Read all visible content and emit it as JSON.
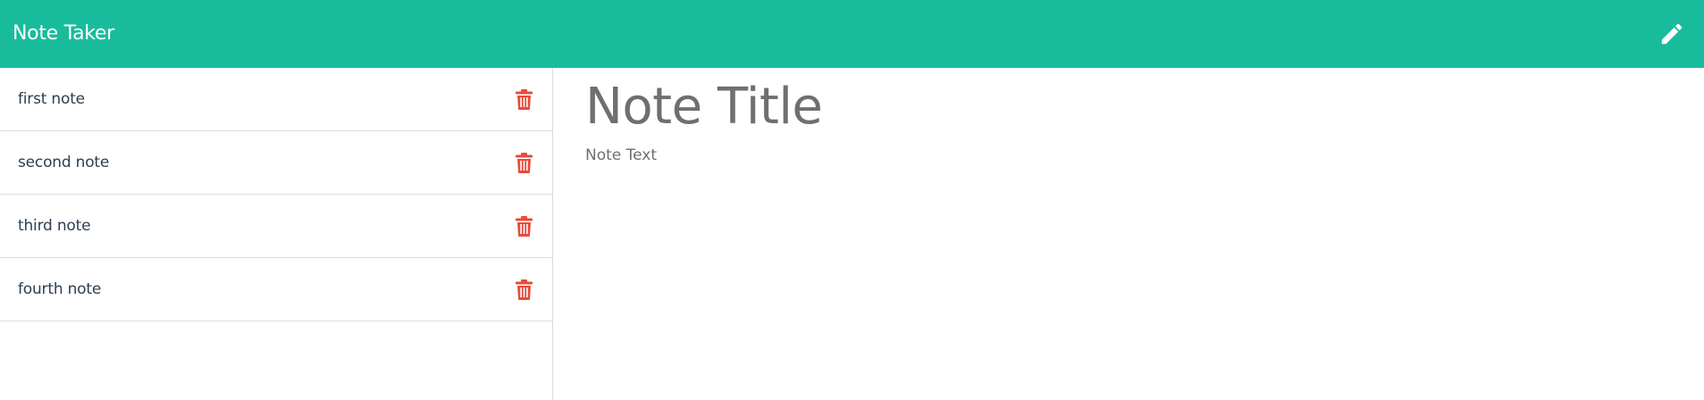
{
  "navbar": {
    "brand": "Note Taker",
    "new_note_icon": "pencil-icon"
  },
  "sidebar": {
    "notes": [
      {
        "label": "first note",
        "delete_icon": "trash-icon"
      },
      {
        "label": "second note",
        "delete_icon": "trash-icon"
      },
      {
        "label": "third note",
        "delete_icon": "trash-icon"
      },
      {
        "label": "fourth note",
        "delete_icon": "trash-icon"
      }
    ]
  },
  "editor": {
    "title_placeholder": "Note Title",
    "title_value": "",
    "text_placeholder": "Note Text",
    "text_value": ""
  },
  "colors": {
    "navbar_bg": "#18bc9c",
    "delete_icon": "#e74c3c",
    "list_text": "#2c3e50",
    "placeholder_text": "#6f6f6f"
  }
}
